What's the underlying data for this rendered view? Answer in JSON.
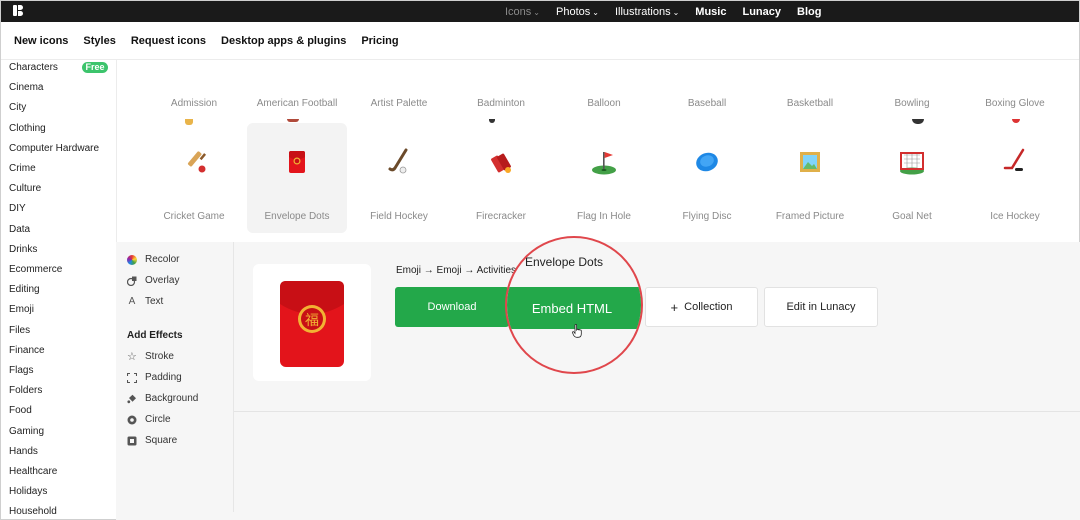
{
  "topnav": {
    "items": [
      {
        "label": "Icons",
        "chevron": true,
        "dim": true
      },
      {
        "label": "Photos",
        "chevron": true
      },
      {
        "label": "Illustrations",
        "chevron": true
      },
      {
        "label": "Music",
        "bold": true
      },
      {
        "label": "Lunacy",
        "bold": true
      },
      {
        "label": "Blog",
        "bold": true
      }
    ]
  },
  "subnav": [
    "New icons",
    "Styles",
    "Request icons",
    "Desktop apps & plugins",
    "Pricing"
  ],
  "sidebar": {
    "badge": "Free",
    "categories": [
      "Characters",
      "Cinema",
      "City",
      "Clothing",
      "Computer Hardware",
      "Crime",
      "Culture",
      "DIY",
      "Data",
      "Drinks",
      "Ecommerce",
      "Editing",
      "Emoji",
      "Files",
      "Finance",
      "Flags",
      "Folders",
      "Food",
      "Gaming",
      "Hands",
      "Healthcare",
      "Holidays",
      "Household"
    ]
  },
  "grid": {
    "row1": [
      "Admission",
      "American Football",
      "Artist Palette",
      "Badminton",
      "Balloon",
      "Baseball",
      "Basketball",
      "Bowling",
      "Boxing Glove"
    ],
    "row2": [
      "Cricket Game",
      "Envelope Dots",
      "Field Hockey",
      "Firecracker",
      "Flag In Hole",
      "Flying Disc",
      "Framed Picture",
      "Goal Net",
      "Ice Hockey"
    ],
    "icons_row2": [
      "cricket-bat-icon",
      "red-envelope-icon",
      "field-hockey-icon",
      "firecracker-icon",
      "flag-in-hole-icon",
      "flying-disc-icon",
      "framed-picture-icon",
      "goal-net-icon",
      "ice-hockey-icon"
    ]
  },
  "options": {
    "basic": [
      "Recolor",
      "Overlay",
      "Text"
    ],
    "effects_heading": "Add Effects",
    "effects": [
      "Stroke",
      "Padding",
      "Background",
      "Circle",
      "Square"
    ]
  },
  "detail": {
    "breadcrumb": "Emoji → Emoji → Activities",
    "title": "Envelope Dots",
    "download": "Download",
    "embed": "Embed HTML",
    "collection": "Collection",
    "collection_prefix": "+",
    "edit": "Edit in Lunacy"
  },
  "colors": {
    "accent_green": "#23a84a",
    "badge_green": "#3cc46c",
    "highlight_red": "#e0474c"
  }
}
